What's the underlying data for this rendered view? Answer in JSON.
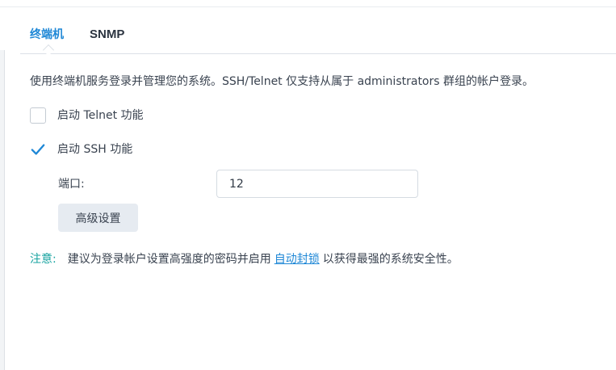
{
  "tabs": [
    {
      "label": "终端机",
      "active": true
    },
    {
      "label": "SNMP",
      "active": false
    }
  ],
  "description": "使用终端机服务登录并管理您的系统。SSH/Telnet 仅支持从属于 administrators 群组的帐户登录。",
  "options": {
    "telnet": {
      "label": "启动 Telnet 功能",
      "checked": false
    },
    "ssh": {
      "label": "启动 SSH 功能",
      "checked": true
    }
  },
  "port": {
    "label": "端口:",
    "value": "12"
  },
  "advanced_button": "高级设置",
  "note": {
    "label": "注意:",
    "text_before": "建议为登录帐户设置高强度的密码并启用",
    "link": "自动封锁",
    "text_after": "以获得最强的系统安全性。"
  },
  "colors": {
    "accent": "#1e87d6",
    "note": "#17a3a0",
    "check": "#1e87d6"
  },
  "icons": {
    "ssh_checkbox": "checkmark-icon"
  }
}
